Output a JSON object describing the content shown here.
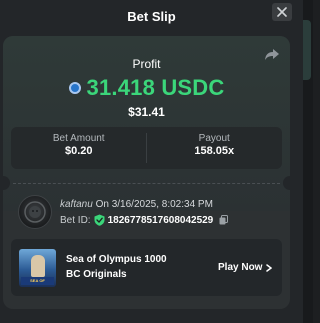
{
  "modal": {
    "title": "Bet Slip"
  },
  "profit": {
    "label": "Profit",
    "amount": "31.418 USDC",
    "fiat": "$31.41",
    "currency_icon": "usdc-coin-icon",
    "color": "#3bd67a"
  },
  "stats": {
    "bet_amount_label": "Bet Amount",
    "bet_amount_value": "$0.20",
    "payout_label": "Payout",
    "payout_value": "158.05x"
  },
  "bet_info": {
    "username": "kaftanu",
    "date_prefix": " On ",
    "datetime": "3/16/2025, 8:02:34 PM",
    "bet_id_label": "Bet ID:",
    "bet_id": "182677851760804252​9"
  },
  "game": {
    "name": "Sea of Olympus 1000",
    "provider": "BC Originals",
    "play_label": "Play Now",
    "thumb_banner": "SEA OF OLYMPUS"
  },
  "icons": {
    "close": "close-icon",
    "share": "share-icon",
    "verified": "shield-check-icon",
    "copy": "copy-icon",
    "chevron": "chevron-right-icon"
  }
}
